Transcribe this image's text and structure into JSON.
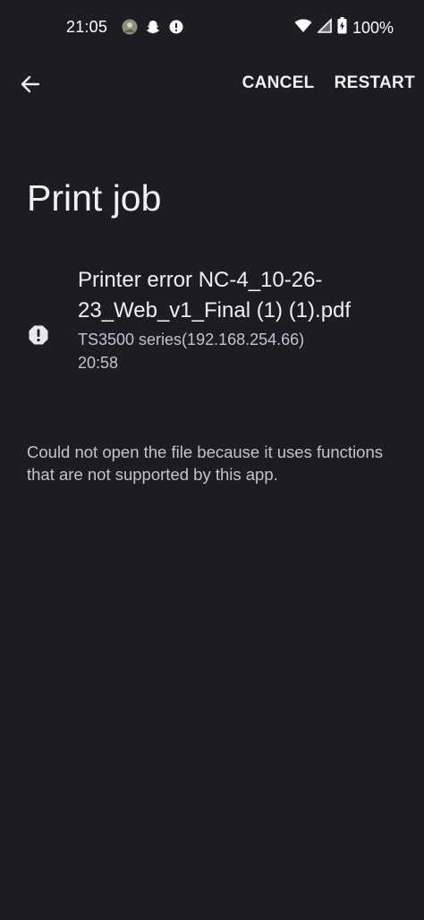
{
  "status_bar": {
    "time": "21:05",
    "battery_percent": "100%",
    "notification_icons": [
      "avatar-icon",
      "snapchat-icon",
      "alert-icon"
    ],
    "system_icons": [
      "wifi-icon",
      "cellular-signal-icon",
      "battery-charging-icon"
    ]
  },
  "toolbar": {
    "back_icon": "arrow-back-icon",
    "cancel_label": "CANCEL",
    "restart_label": "RESTART"
  },
  "page": {
    "title": "Print job"
  },
  "job": {
    "status_icon": "error-icon",
    "name": "Printer error NC-4_10-26-23_Web_v1_Final (1) (1).pdf",
    "printer": "TS3500 series(192.168.254.66)",
    "time": "20:58"
  },
  "message": "Could not open the file because it uses functions that are not supported by this app.",
  "colors": {
    "background": "#1d1c22",
    "primary_text": "#f1eef5",
    "secondary_text": "#c5c2cc"
  }
}
